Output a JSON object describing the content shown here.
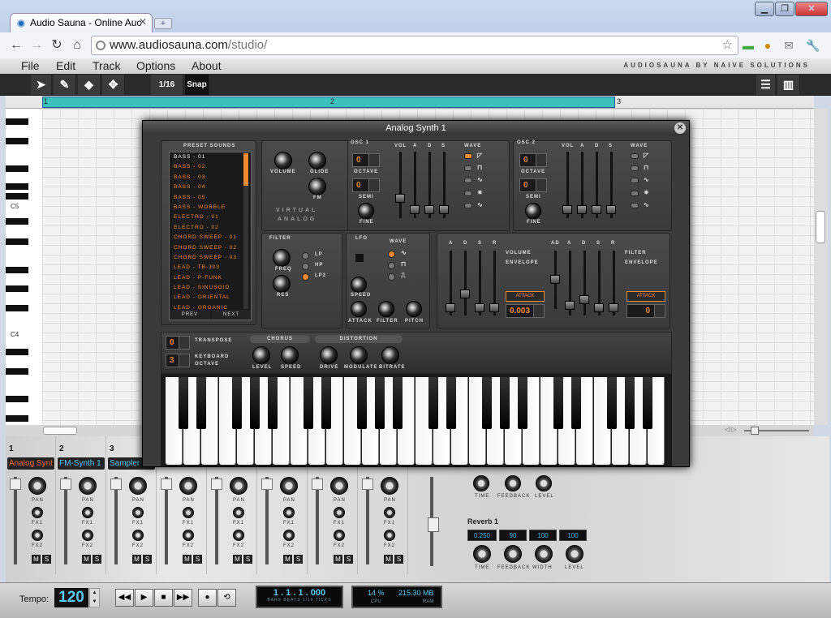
{
  "browser": {
    "tab_title": "Audio Sauna - Online Auc",
    "new_tab_label": "+",
    "url_host": "www.audiosauna.com",
    "url_path": "/studio/"
  },
  "menu": {
    "items": [
      "File",
      "Edit",
      "Track",
      "Options",
      "About"
    ],
    "brand": "AUDIOSAUNA BY NAIVE SOLUTIONS"
  },
  "toolbar": {
    "quantize": "1/16",
    "snap": "Snap"
  },
  "timeline": {
    "markers": [
      "1",
      "2",
      "3"
    ]
  },
  "piano_roll": {
    "key_labels": [
      "C5",
      "C4"
    ]
  },
  "synth": {
    "title": "Analog Synth 1",
    "preset_header": "PRESET SOUNDS",
    "presets": [
      "BASS - 01",
      "BASS - 02",
      "BASS - 03",
      "BASS - 04",
      "BASS - 05",
      "BASS - WOBBLE",
      "ELECTRO - 01",
      "ELECTRO - 02",
      "CHORD SWEEP - 01",
      "CHORD SWEEP - 02",
      "CHORD SWEEP - 03",
      "LEAD - TB-303",
      "LEAD - P-FUNK",
      "LEAD - SINUSOID",
      "LEAD - ORIENTAL",
      "LEAD - ORGANIC"
    ],
    "prev": "PREV",
    "next": "NEXT",
    "main_labels": {
      "volume": "VOLUME",
      "glide": "GLIDE",
      "fm": "FM",
      "brand1": "VIRTUAL",
      "brand2": "ANALOG"
    },
    "osc1": {
      "title": "OSC 1",
      "octave_label": "OCTAVE",
      "semi_label": "SEMI",
      "fine_label": "FINE",
      "octave": "0",
      "semi": "0"
    },
    "osc2": {
      "title": "OSC 2",
      "octave_label": "OCTAVE",
      "semi_label": "SEMI",
      "fine_label": "FINE",
      "octave": "0",
      "semi": "0"
    },
    "env_cols": [
      "VOL",
      "A",
      "D",
      "S"
    ],
    "wave_label": "WAVE",
    "filter": {
      "title": "FILTER",
      "freq": "FREQ",
      "res": "RES",
      "modes": [
        "LP",
        "HP",
        "LP2"
      ]
    },
    "lfo": {
      "title": "LFO",
      "wave": "WAVE",
      "speed": "SPEED",
      "attack": "ATTACK",
      "filter": "FILTER",
      "pitch": "PITCH"
    },
    "vol_env": {
      "cols": [
        "A",
        "D",
        "S",
        "R"
      ],
      "title1": "VOLUME",
      "title2": "ENVELOPE",
      "attack_btn": "ATTACK",
      "value": "0.003"
    },
    "filt_env": {
      "cols": [
        "AD",
        "A",
        "D",
        "S",
        "R"
      ],
      "title1": "FILTER",
      "title2": "ENVELOPE",
      "attack_btn": "ATTACK",
      "value": "0"
    },
    "transpose": {
      "label": "TRANSPOSE",
      "value": "0"
    },
    "kb_octave": {
      "label1": "KEYBOARD",
      "label2": "OCTAVE",
      "value": "3"
    },
    "chorus": {
      "title": "CHORUS",
      "level": "LEVEL",
      "speed": "SPEED"
    },
    "distortion": {
      "title": "DISTORTION",
      "drive": "DRIVE",
      "modulate": "MODULATE",
      "bitrate": "BITRATE"
    }
  },
  "mixer": {
    "channels": [
      {
        "num": "1",
        "name": "Analog Synt",
        "color": "#f06a3a"
      },
      {
        "num": "2",
        "name": "FM-Synth 1",
        "color": "#5ac8f5"
      },
      {
        "num": "3",
        "name": "Sampler",
        "color": "#5ac8f5"
      },
      {
        "num": "",
        "name": "",
        "color": "#5ac8f5"
      },
      {
        "num": "",
        "name": "",
        "color": "#5ac8f5"
      },
      {
        "num": "",
        "name": "",
        "color": "#5ac8f5"
      },
      {
        "num": "",
        "name": "",
        "color": "#5ac8f5"
      },
      {
        "num": "",
        "name": "",
        "color": "#5ac8f5"
      }
    ],
    "knob_labels": [
      "PAN",
      "FX1",
      "FX2"
    ],
    "mute": "M",
    "solo": "S",
    "delay_labels": [
      "TIME",
      "FEEDBACK",
      "LEVEL"
    ],
    "reverb": {
      "title": "Reverb 1",
      "values": [
        "0.250",
        "90",
        "100",
        "100"
      ],
      "labels": [
        "TIME",
        "FEEDBACK",
        "WIDTH",
        "LEVEL"
      ]
    }
  },
  "transport": {
    "tempo_label": "Tempo:",
    "tempo": "120",
    "position": "1 . 1 . 1 . 000",
    "position_sub": "BARS BEATS 1/16 TICKS",
    "cpu": "14 %",
    "ram": "215.30 MB",
    "cpu_label": "CPU",
    "ram_label": "RAM"
  }
}
